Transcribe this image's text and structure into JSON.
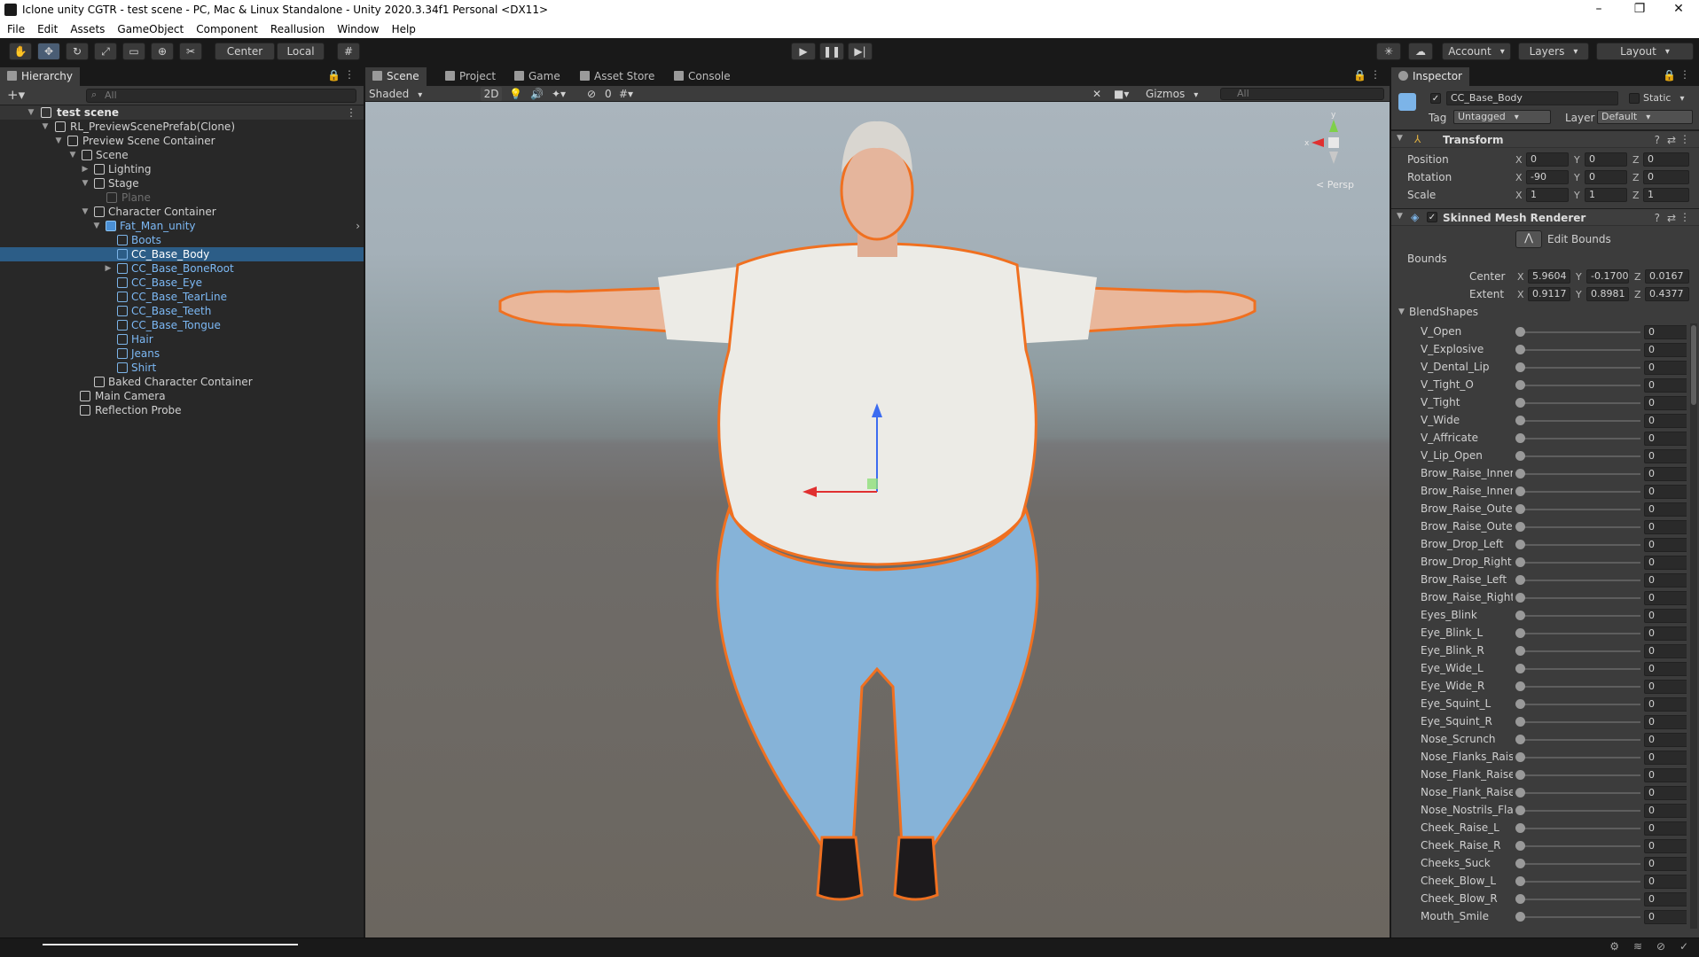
{
  "window": {
    "title": "Iclone unity CGTR - test scene - PC, Mac & Linux Standalone - Unity 2020.3.34f1 Personal <DX11>",
    "controls": [
      "–",
      "❐",
      "✕"
    ]
  },
  "menu": [
    "File",
    "Edit",
    "Assets",
    "GameObject",
    "Component",
    "Reallusion",
    "Window",
    "Help"
  ],
  "toolbar": {
    "center_label": "Center",
    "local_label": "Local",
    "account_label": "Account",
    "layers_label": "Layers",
    "layout_label": "Layout"
  },
  "hierarchy": {
    "tab_label": "Hierarchy",
    "search_placeholder": "All",
    "items": [
      {
        "label": "test scene",
        "depth": 0
      },
      {
        "label": "RL_PreviewScenePrefab(Clone)",
        "depth": 1
      },
      {
        "label": "Preview Scene Container",
        "depth": 2
      },
      {
        "label": "Scene",
        "depth": 3
      },
      {
        "label": "Lighting",
        "depth": 4
      },
      {
        "label": "Stage",
        "depth": 4
      },
      {
        "label": "Plane",
        "depth": 5
      },
      {
        "label": "Character Container",
        "depth": 3
      },
      {
        "label": "Fat_Man_unity",
        "depth": 4
      },
      {
        "label": "Boots",
        "depth": 5
      },
      {
        "label": "CC_Base_Body",
        "depth": 5
      },
      {
        "label": "CC_Base_BoneRoot",
        "depth": 5
      },
      {
        "label": "CC_Base_Eye",
        "depth": 5
      },
      {
        "label": "CC_Base_TearLine",
        "depth": 5
      },
      {
        "label": "CC_Base_Teeth",
        "depth": 5
      },
      {
        "label": "CC_Base_Tongue",
        "depth": 5
      },
      {
        "label": "Hair",
        "depth": 5
      },
      {
        "label": "Jeans",
        "depth": 5
      },
      {
        "label": "Shirt",
        "depth": 5
      },
      {
        "label": "Baked Character Container",
        "depth": 3
      },
      {
        "label": "Main Camera",
        "depth": 2
      },
      {
        "label": "Reflection Probe",
        "depth": 2
      }
    ]
  },
  "scene": {
    "tabs": [
      "Scene",
      "Project",
      "Game",
      "Asset Store",
      "Console"
    ],
    "shading_mode": "Shaded",
    "mode_2d": "2D",
    "hidden_count": "0",
    "gizmos_label": "Gizmos",
    "search_placeholder": "All",
    "persp_label": "< Persp",
    "axis_y": "y",
    "axis_x": "x"
  },
  "inspector": {
    "tab_label": "Inspector",
    "object_name": "CC_Base_Body",
    "static_label": "Static",
    "tag_label": "Tag",
    "tag_value": "Untagged",
    "layer_label": "Layer",
    "layer_value": "Default",
    "transform": {
      "title": "Transform",
      "position_label": "Position",
      "rotation_label": "Rotation",
      "scale_label": "Scale",
      "position": [
        "0",
        "0",
        "0"
      ],
      "rotation": [
        "-90",
        "0",
        "0"
      ],
      "scale": [
        "1",
        "1",
        "1"
      ]
    },
    "skinned": {
      "title": "Skinned Mesh Renderer",
      "edit_bounds_label": "Edit Bounds",
      "bounds_label": "Bounds",
      "center_label": "Center",
      "extent_label": "Extent",
      "center": [
        "5.9604",
        "-0.1700",
        "0.0167"
      ],
      "extent": [
        "0.9117",
        "0.8981",
        "0.4377"
      ]
    },
    "blendshapes_label": "BlendShapes",
    "blendshapes": [
      {
        "name": "V_Open",
        "value": "0"
      },
      {
        "name": "V_Explosive",
        "value": "0"
      },
      {
        "name": "V_Dental_Lip",
        "value": "0"
      },
      {
        "name": "V_Tight_O",
        "value": "0"
      },
      {
        "name": "V_Tight",
        "value": "0"
      },
      {
        "name": "V_Wide",
        "value": "0"
      },
      {
        "name": "V_Affricate",
        "value": "0"
      },
      {
        "name": "V_Lip_Open",
        "value": "0"
      },
      {
        "name": "Brow_Raise_Inner_",
        "value": "0"
      },
      {
        "name": "Brow_Raise_Inner_",
        "value": "0"
      },
      {
        "name": "Brow_Raise_Outer_",
        "value": "0"
      },
      {
        "name": "Brow_Raise_Outer_",
        "value": "0"
      },
      {
        "name": "Brow_Drop_Left",
        "value": "0"
      },
      {
        "name": "Brow_Drop_Right",
        "value": "0"
      },
      {
        "name": "Brow_Raise_Left",
        "value": "0"
      },
      {
        "name": "Brow_Raise_Right",
        "value": "0"
      },
      {
        "name": "Eyes_Blink",
        "value": "0"
      },
      {
        "name": "Eye_Blink_L",
        "value": "0"
      },
      {
        "name": "Eye_Blink_R",
        "value": "0"
      },
      {
        "name": "Eye_Wide_L",
        "value": "0"
      },
      {
        "name": "Eye_Wide_R",
        "value": "0"
      },
      {
        "name": "Eye_Squint_L",
        "value": "0"
      },
      {
        "name": "Eye_Squint_R",
        "value": "0"
      },
      {
        "name": "Nose_Scrunch",
        "value": "0"
      },
      {
        "name": "Nose_Flanks_Raise",
        "value": "0"
      },
      {
        "name": "Nose_Flank_Raise_",
        "value": "0"
      },
      {
        "name": "Nose_Flank_Raise_",
        "value": "0"
      },
      {
        "name": "Nose_Nostrils_Flar",
        "value": "0"
      },
      {
        "name": "Cheek_Raise_L",
        "value": "0"
      },
      {
        "name": "Cheek_Raise_R",
        "value": "0"
      },
      {
        "name": "Cheeks_Suck",
        "value": "0"
      },
      {
        "name": "Cheek_Blow_L",
        "value": "0"
      },
      {
        "name": "Cheek_Blow_R",
        "value": "0"
      },
      {
        "name": "Mouth_Smile",
        "value": "0"
      }
    ]
  }
}
